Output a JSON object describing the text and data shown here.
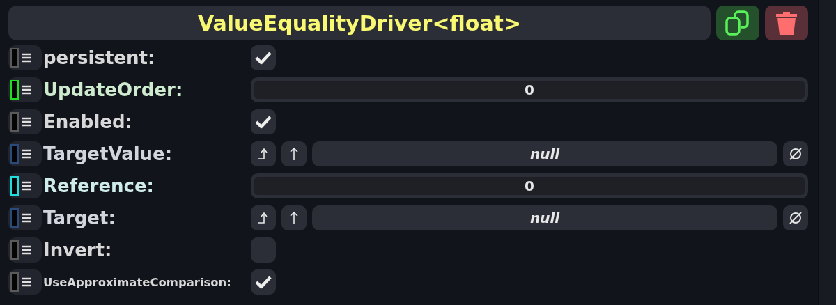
{
  "header": {
    "title": "ValueEqualityDriver<float>"
  },
  "fields": [
    {
      "kind": "checkbox",
      "label": "persistent:",
      "color": "#5a5a5a",
      "checked": true
    },
    {
      "kind": "number",
      "label": "UpdateOrder:",
      "color": "#22dd22",
      "value": "0"
    },
    {
      "kind": "checkbox",
      "label": "Enabled:",
      "color": "#5a5a5a",
      "checked": true
    },
    {
      "kind": "reference",
      "label": "TargetValue:",
      "color": "#2a4a7a",
      "value": "null"
    },
    {
      "kind": "number",
      "label": "Reference:",
      "color": "#22dddd",
      "value": "0"
    },
    {
      "kind": "reference",
      "label": "Target:",
      "color": "#2a4a7a",
      "value": "null"
    },
    {
      "kind": "checkbox",
      "label": "Invert:",
      "color": "#5a5a5a",
      "checked": false
    },
    {
      "kind": "checkbox",
      "label": "UseApproximateComparison:",
      "color": "#5a5a5a",
      "checked": true
    }
  ]
}
